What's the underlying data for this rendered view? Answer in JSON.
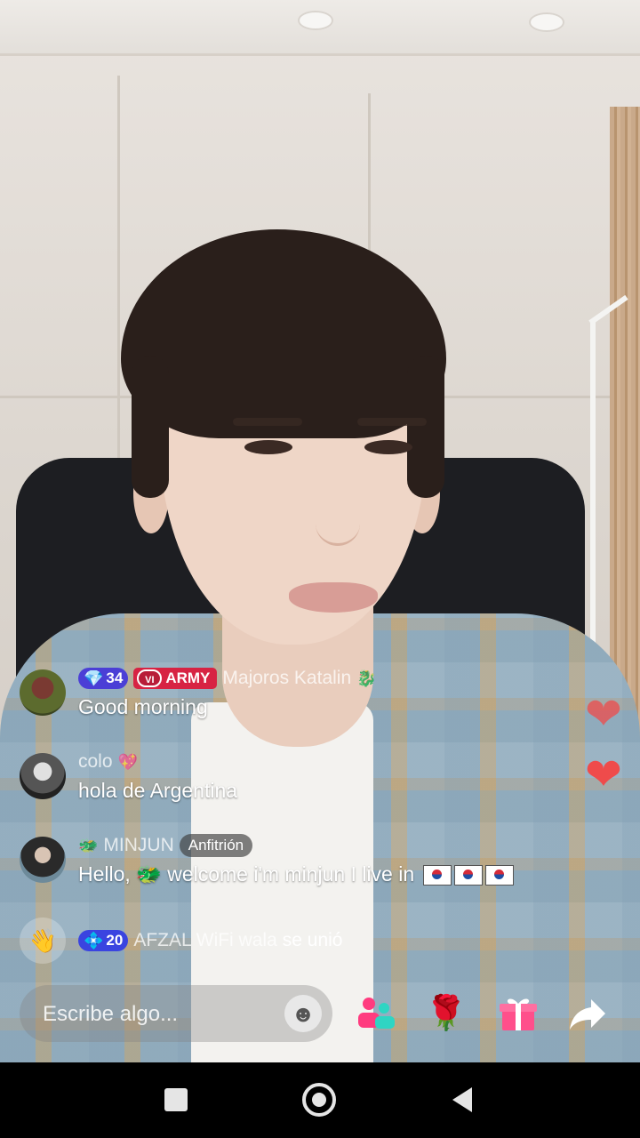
{
  "chat": [
    {
      "type": "message",
      "level": "34",
      "fan_badge": "ARMY",
      "fan_badge_icon": "VI",
      "username": "Majoros Katalin",
      "text": "Good morning"
    },
    {
      "type": "message",
      "username": "colo",
      "text": "hola de Argentina"
    },
    {
      "type": "message",
      "username": "MINJUN",
      "host_badge": "Anfitrión",
      "text": "Hello, 🐲 welcome i'm minjun I live in"
    },
    {
      "type": "join",
      "level": "20",
      "username": "AFZAL WiFi wala",
      "text": "se unió"
    }
  ],
  "composer": {
    "placeholder": "Escribe algo..."
  },
  "icons": {
    "emoji": "smiley-icon",
    "cohost": "people-icon",
    "rose": "rose-gift-icon",
    "gift": "gift-box-icon",
    "share": "share-arrow-icon",
    "nav_recents": "square-icon",
    "nav_home": "circle-icon",
    "nav_back": "triangle-back-icon"
  },
  "colors": {
    "fan_badge": "#d72343",
    "level_badge": "#4b3fd6",
    "heart": "#ef4b4b",
    "cohost_icon": "#ff3b7f",
    "gift_icon": "#ff4f8b"
  }
}
